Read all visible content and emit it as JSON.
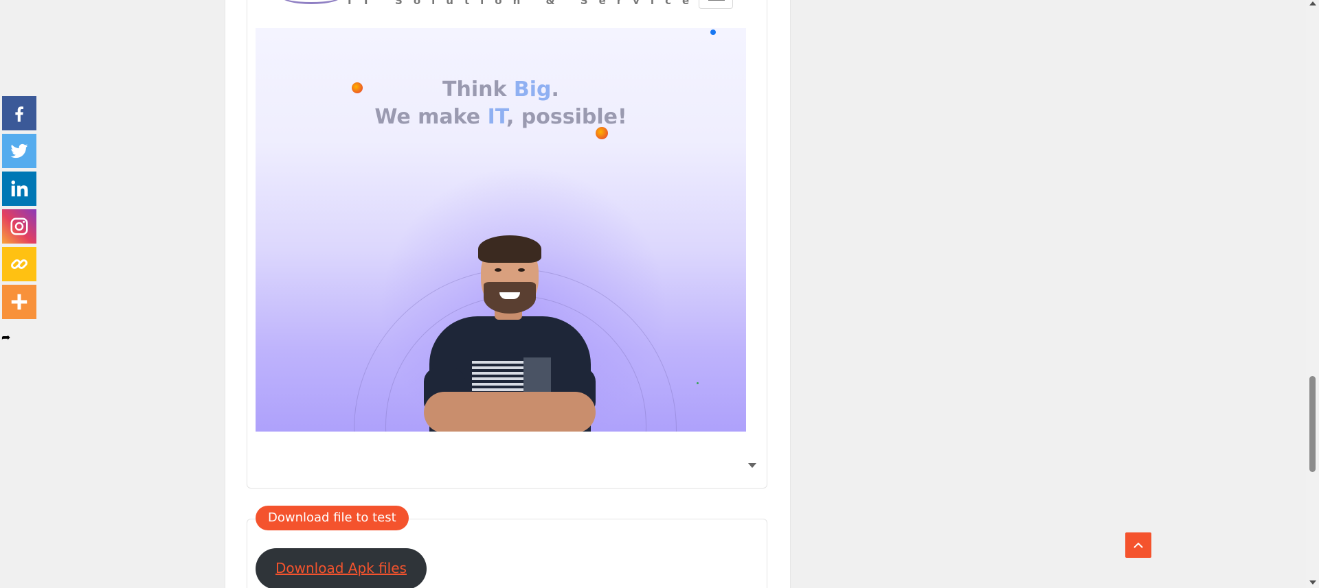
{
  "hero": {
    "line1_part1": "Think ",
    "line1_accent": "Big",
    "line1_end": ".",
    "line2_part1": "We make ",
    "line2_accent": "IT",
    "line2_end": ", possible!"
  },
  "logo": {
    "tagline": "IT Solution & Services"
  },
  "download": {
    "badge_label": "Download file to test",
    "apk_button_label": "Download Apk files"
  },
  "share_bar": {
    "items": [
      "facebook-icon",
      "twitter-icon",
      "linkedin-icon",
      "instagram-icon",
      "copy-link-icon",
      "more-icon"
    ],
    "hide_icon": "collapse-arrow-icon"
  },
  "colors": {
    "accent_orange": "#f4532d",
    "headline_gray": "#9a9ab0",
    "headline_accent": "#8fb0f2",
    "apk_button_bg": "#2f3439"
  }
}
